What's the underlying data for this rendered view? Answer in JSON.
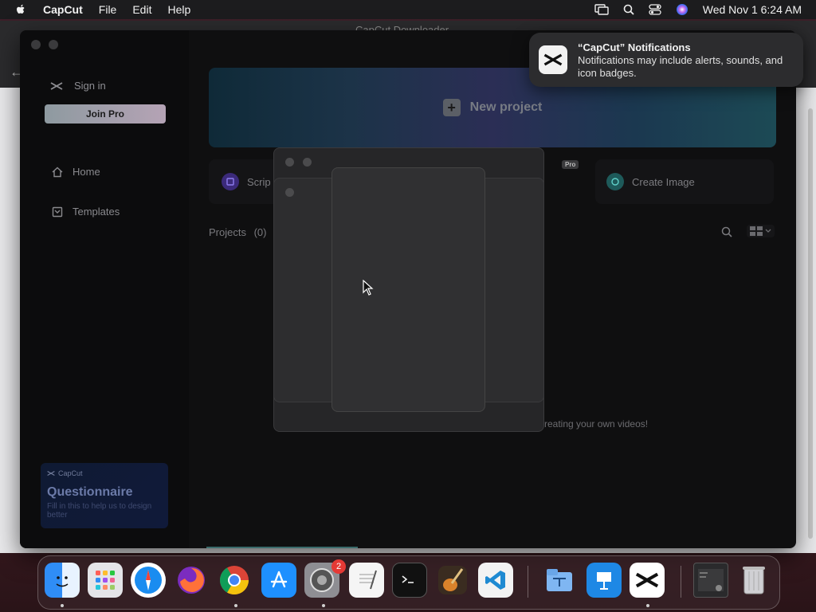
{
  "menubar": {
    "app_name": "CapCut",
    "menus": [
      "File",
      "Edit",
      "Help"
    ],
    "clock": "Wed Nov 1  6:24 AM"
  },
  "background_window": {
    "title": "CapCut Downloader"
  },
  "sidebar": {
    "sign_in": "Sign in",
    "join_pro": "Join Pro",
    "nav": [
      {
        "label": "Home"
      },
      {
        "label": "Templates"
      }
    ],
    "questionnaire": {
      "brand": "CapCut",
      "title": "Questionnaire",
      "subtitle": "Fill in this to help us to design better"
    }
  },
  "main": {
    "new_project": "New project",
    "tools": {
      "script": "Scrip",
      "pro_tag": "Pro",
      "create_image": "Create Image"
    },
    "projects_label": "Projects",
    "projects_count": "(0)",
    "empty_message": "creating your own videos!"
  },
  "notification": {
    "title": "“CapCut” Notifications",
    "body": "Notifications may include alerts, sounds, and icon badges."
  },
  "dock": {
    "settings_badge": "2",
    "apps": [
      "finder-icon",
      "launchpad-icon",
      "safari-icon",
      "firefox-icon",
      "chrome-icon",
      "app-store-icon",
      "system-settings-icon",
      "textedit-icon",
      "terminal-icon",
      "garageband-icon",
      "vscode-icon",
      "finder-folder-icon",
      "keynote-icon",
      "capcut-icon",
      "window-thumbnail-icon",
      "trash-icon"
    ]
  },
  "colors": {
    "accent_pro": "#b5a3b5",
    "badge_red": "#e53935"
  }
}
